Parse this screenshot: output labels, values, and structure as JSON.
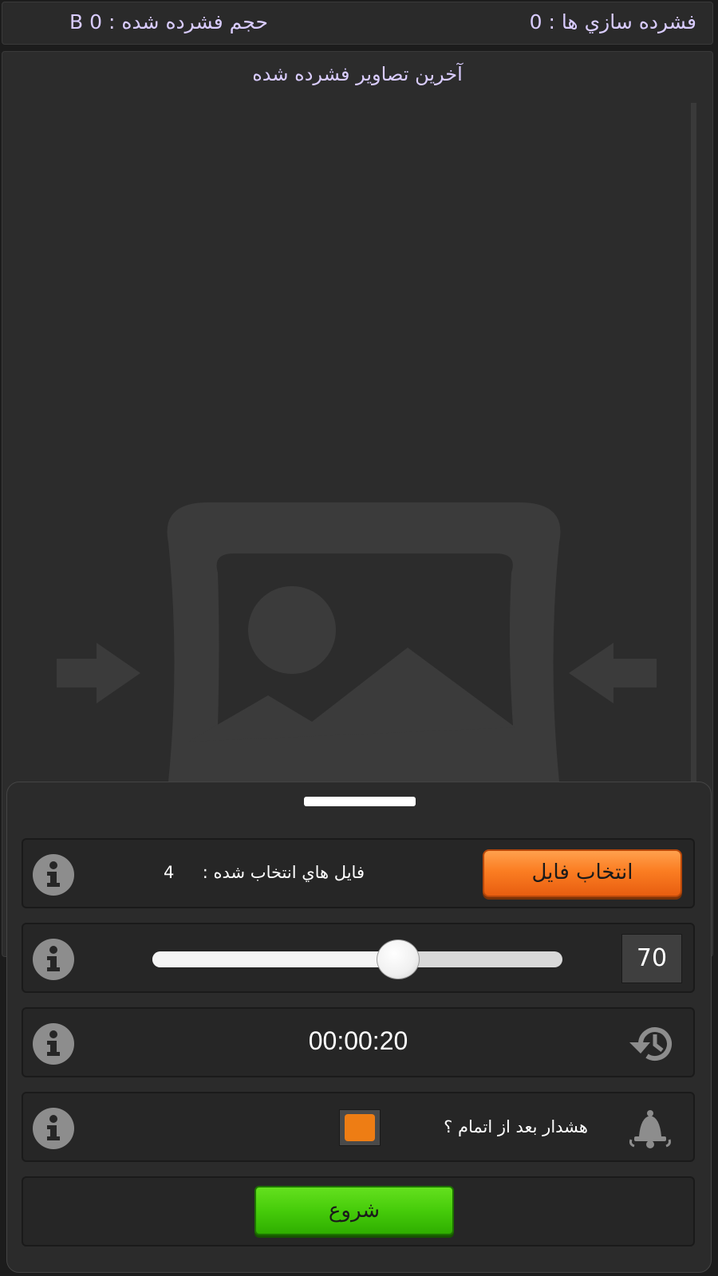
{
  "topbar": {
    "compressions_label": "فشرده سازي ها : 0",
    "compressed_size_label": "حجم فشرده شده : 0 B"
  },
  "recent": {
    "title": "آخرين تصاوير فشرده شده",
    "placeholder_icon": "image-compress-icon"
  },
  "controls": {
    "select_file_label": "انتخاب فايل",
    "selected_files_label": "فايل هاي انتخاب شده :",
    "selected_files_count": "4",
    "quality_value": "70",
    "quality_fraction": 0.6,
    "timer": "00:00:20",
    "alert_label": "هشدار بعد از اتمام ؟",
    "alert_checked": true,
    "start_label": "شروع"
  },
  "colors": {
    "accent_orange": "#ee7d14",
    "start_green": "#46cc0a",
    "header_text": "#d9ccff"
  },
  "icons": {
    "info": "info-icon",
    "history": "history-icon",
    "bell": "bell-icon"
  }
}
